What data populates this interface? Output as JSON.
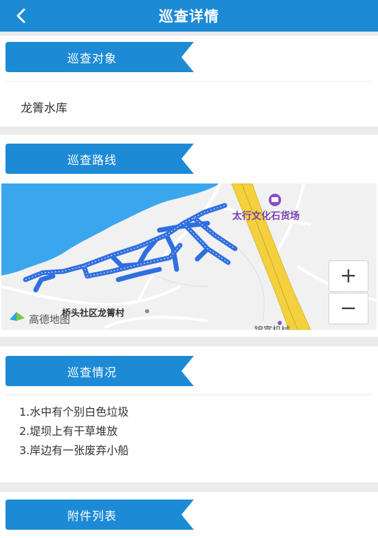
{
  "header": {
    "title": "巡查详情"
  },
  "sections": {
    "object": {
      "label": "巡查对象",
      "value": "龙箐水库"
    },
    "route": {
      "label": "巡查路线"
    },
    "situation": {
      "label": "巡查情况",
      "lines": [
        "1.水中有个别白色垃圾",
        "2.堤坝上有干草堆放",
        "3.岸边有一张废弃小船"
      ]
    },
    "attachments": {
      "label": "附件列表"
    }
  },
  "map": {
    "poi_label": "太行文化石货场",
    "place_label": "桥头社区龙箐村",
    "cut_label": "锦富机械",
    "logo_text": "高德地图",
    "zoom_in": "+",
    "zoom_out": "−",
    "colors": {
      "water": "#3aa6ee",
      "road": "#f4d03f",
      "route": "#2f6fe0",
      "poi": "#8a4fc0"
    }
  },
  "colors": {
    "accent": "#1d8ad6",
    "background": "#ebebeb"
  }
}
